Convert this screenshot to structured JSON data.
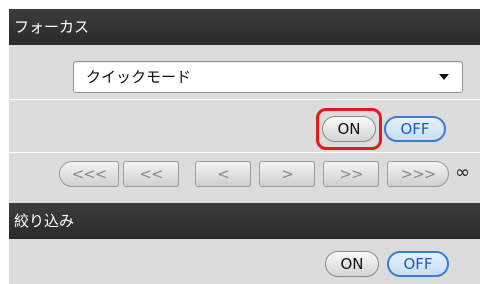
{
  "focus": {
    "header": "フォーカス",
    "mode_selected": "クイックモード",
    "on_label": "ON",
    "off_label": "OFF",
    "steps": [
      "<<<",
      "<<",
      "<",
      ">",
      ">>",
      ">>>"
    ],
    "infinity": "∞"
  },
  "aperture": {
    "header": "絞り込み",
    "on_label": "ON",
    "off_label": "OFF"
  },
  "colors": {
    "header_bg": "#333333",
    "panel_bg": "#d9d9d9",
    "off_accent": "#3a7cd8",
    "highlight": "#e21a1a"
  }
}
